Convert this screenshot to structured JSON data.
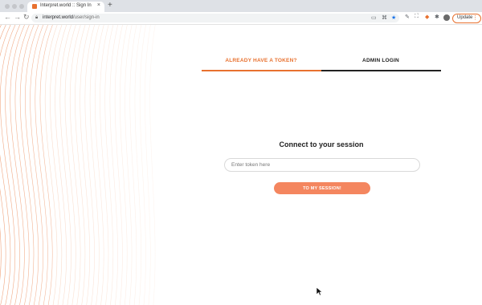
{
  "browser": {
    "tab_title": "Interpret.world :: Sign In",
    "tab_close": "×",
    "new_tab": "+",
    "url_host": "interpret.world",
    "url_path": "/user/sign-in",
    "update_label": "Update",
    "update_menu": "⋮",
    "back": "←",
    "forward": "→",
    "reload": "↻",
    "accent_color": "#e8712f"
  },
  "auth": {
    "tabs": [
      {
        "label": "ALREADY HAVE A TOKEN?",
        "active": true
      },
      {
        "label": "ADMIN LOGIN",
        "active": false
      }
    ],
    "heading": "Connect to your session",
    "token_placeholder": "Enter token here",
    "token_value": "",
    "submit_label": "TO MY SESSION!",
    "button_color": "#f4865f"
  }
}
